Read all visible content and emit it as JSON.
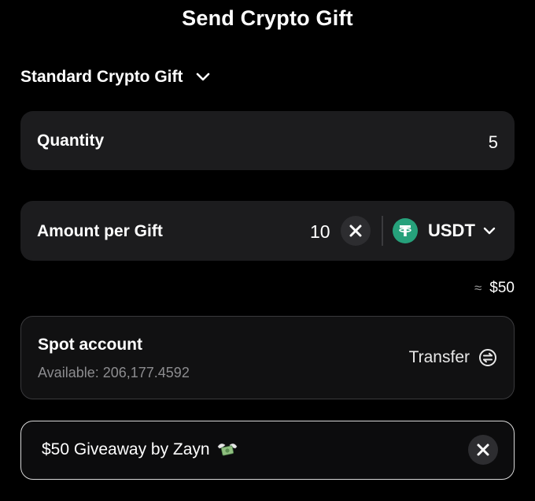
{
  "header": {
    "title": "Send Crypto Gift"
  },
  "gift_type": {
    "selected": "Standard Crypto Gift",
    "icon": "chevron-down-icon"
  },
  "quantity": {
    "label": "Quantity",
    "value": "5"
  },
  "amount": {
    "label": "Amount per Gift",
    "value": "10",
    "clear_icon": "close-icon",
    "currency": "USDT",
    "currency_icon": "tether-icon",
    "currency_color": "#26a17b"
  },
  "estimate": {
    "symbol": "≈",
    "value": "$50"
  },
  "account": {
    "label": "Spot account",
    "available": "Available: 206,177.4592",
    "transfer_label": "Transfer",
    "transfer_icon": "transfer-icon"
  },
  "message": {
    "text": "$50 Giveaway by Zayn",
    "emoji_icon": "money-with-wings-icon",
    "clear_icon": "close-icon"
  },
  "colors": {
    "background": "#000000",
    "card": "#1c1c1e",
    "text": "#ffffff",
    "muted": "#8c8c8f",
    "accent_usdt": "#26a17b"
  }
}
